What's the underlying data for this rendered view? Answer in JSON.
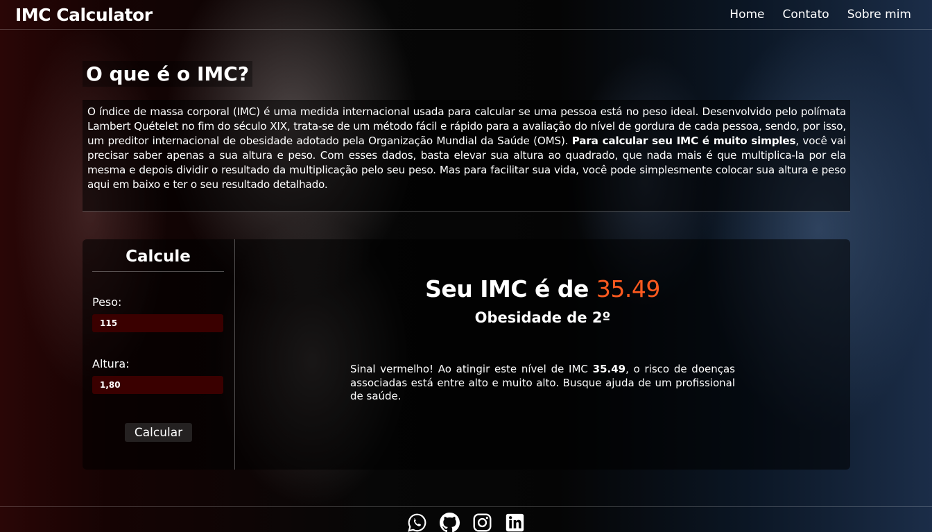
{
  "navbar": {
    "brand": "IMC Calculator",
    "links": [
      "Home",
      "Contato",
      "Sobre mim"
    ]
  },
  "about": {
    "title": "O que é o IMC?",
    "text_part1": "O índice de massa corporal (IMC) é uma medida internacional usada para calcular se uma pessoa está no peso ideal. Desenvolvido pelo polímata Lambert Quételet no fim do século XIX, trata-se de um método fácil e rápido para a avaliação do nível de gordura de cada pessoa, sendo, por isso, um preditor internacional de obesidade adotado pela Organização Mundial da Saúde (OMS). ",
    "text_bold": "Para calcular seu IMC é muito simples",
    "text_part2": ", você vai precisar saber apenas a sua altura e peso. Com esses dados, basta elevar sua altura ao quadrado, que nada mais é que multiplica-la por ela mesma e depois dividir o resultado da multiplicação pelo seu peso. Mas para facilitar sua vida, você pode simplesmente colocar sua altura e peso aqui em baixo e ter o seu resultado detalhado."
  },
  "calculator": {
    "title": "Calcule",
    "weight_label": "Peso:",
    "weight_value": "115",
    "height_label": "Altura:",
    "height_value": "1,80",
    "button_label": "Calcular"
  },
  "result": {
    "heading_prefix": "Seu IMC é de ",
    "imc_value": "35.49",
    "classification": "Obesidade de 2º",
    "msg_part1": "Sinal vermelho! Ao atingir este nível de IMC ",
    "msg_bold": "35.49",
    "msg_part2": ", o risco de doenças associadas está entre alto e muito alto. Busque ajuda de um profissional de saúde."
  },
  "footer": {
    "icons": [
      "whatsapp-icon",
      "github-icon",
      "instagram-icon",
      "linkedin-icon"
    ]
  },
  "colors": {
    "accent": "#ff5a1f",
    "input_bg": "#3a0000"
  }
}
